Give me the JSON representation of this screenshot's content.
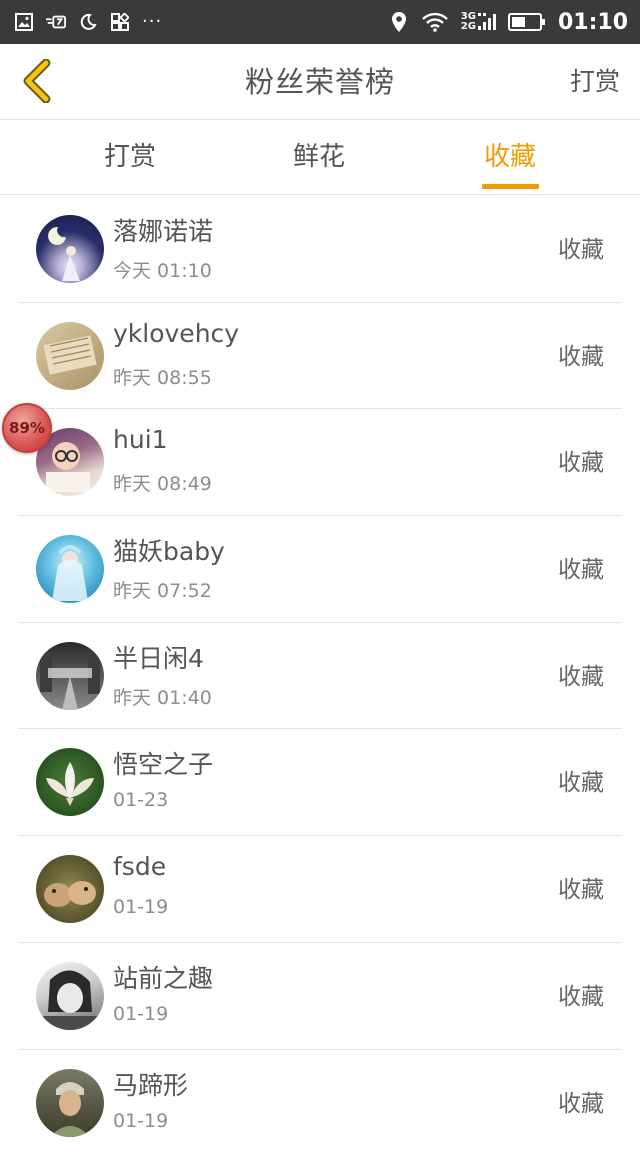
{
  "status_bar": {
    "time": "01:10",
    "network": [
      "3G",
      "2G"
    ],
    "more": "···"
  },
  "header": {
    "title": "粉丝荣誉榜",
    "action_label": "打赏",
    "accent_color": "#f29b05"
  },
  "tabs": [
    {
      "label": "打赏",
      "active": false
    },
    {
      "label": "鲜花",
      "active": false
    },
    {
      "label": "收藏",
      "active": true
    }
  ],
  "floating_badge": "89%",
  "fans": [
    {
      "name": "落娜诺诺",
      "time": "今天  01:10",
      "action": "收藏",
      "avatar": "avatar-moon-girl"
    },
    {
      "name": "yklovehcy",
      "time": "昨天  08:55",
      "action": "收藏",
      "avatar": "avatar-notebook"
    },
    {
      "name": "hui1",
      "time": "昨天  08:49",
      "action": "收藏",
      "avatar": "avatar-baby-glasses"
    },
    {
      "name": "猫妖baby",
      "time": "昨天  07:52",
      "action": "收藏",
      "avatar": "avatar-fairy"
    },
    {
      "name": "半日闲4",
      "time": "昨天  01:40",
      "action": "收藏",
      "avatar": "avatar-street"
    },
    {
      "name": "悟空之子",
      "time": "01-23",
      "action": "收藏",
      "avatar": "avatar-lotus"
    },
    {
      "name": "fsde",
      "time": "01-19",
      "action": "收藏",
      "avatar": "avatar-animals"
    },
    {
      "name": "站前之趣",
      "time": "01-19",
      "action": "收藏",
      "avatar": "avatar-girl-bw"
    },
    {
      "name": "马蹄形",
      "time": "01-19",
      "action": "收藏",
      "avatar": "avatar-boy"
    }
  ]
}
